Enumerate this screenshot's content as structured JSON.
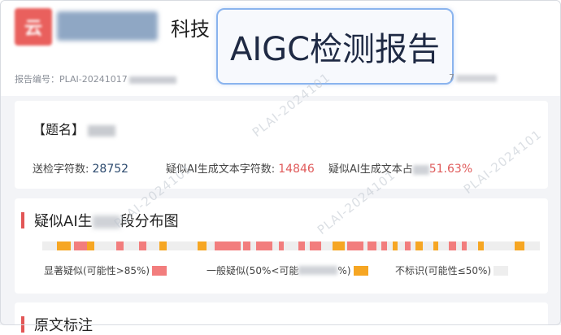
{
  "header": {
    "logo_mark": "云",
    "company_suffix": "科技",
    "report_title": "AIGC检测报告",
    "report_no_label": "报告编号：PLAI-20241017",
    "right_meta_prefix": "7"
  },
  "info": {
    "title_label": "【题名】",
    "stats": [
      {
        "label": "送检字符数: ",
        "value": "28752"
      },
      {
        "label": "疑似AI生成文本字符数: ",
        "value": "14846"
      },
      {
        "label": "疑似AI生成文本占",
        "value": "51.63%"
      }
    ]
  },
  "distribution": {
    "title_prefix": "疑似AI生",
    "title_suffix": "段分布图",
    "segments_fraction": [
      {
        "start": 0.03,
        "end": 0.057,
        "level": "mid"
      },
      {
        "start": 0.064,
        "end": 0.09,
        "level": "high"
      },
      {
        "start": 0.09,
        "end": 0.105,
        "level": "mid"
      },
      {
        "start": 0.148,
        "end": 0.163,
        "level": "high"
      },
      {
        "start": 0.195,
        "end": 0.21,
        "level": "high"
      },
      {
        "start": 0.235,
        "end": 0.249,
        "level": "mid"
      },
      {
        "start": 0.312,
        "end": 0.33,
        "level": "mid"
      },
      {
        "start": 0.347,
        "end": 0.4,
        "level": "high"
      },
      {
        "start": 0.404,
        "end": 0.418,
        "level": "high"
      },
      {
        "start": 0.43,
        "end": 0.463,
        "level": "high"
      },
      {
        "start": 0.475,
        "end": 0.485,
        "level": "high"
      },
      {
        "start": 0.514,
        "end": 0.527,
        "level": "high"
      },
      {
        "start": 0.537,
        "end": 0.56,
        "level": "high"
      },
      {
        "start": 0.583,
        "end": 0.607,
        "level": "mid"
      },
      {
        "start": 0.613,
        "end": 0.646,
        "level": "high"
      },
      {
        "start": 0.654,
        "end": 0.672,
        "level": "high"
      },
      {
        "start": 0.681,
        "end": 0.692,
        "level": "high"
      },
      {
        "start": 0.705,
        "end": 0.715,
        "level": "mid"
      },
      {
        "start": 0.729,
        "end": 0.741,
        "level": "high"
      },
      {
        "start": 0.75,
        "end": 0.764,
        "level": "mid"
      },
      {
        "start": 0.786,
        "end": 0.795,
        "level": "mid"
      },
      {
        "start": 0.817,
        "end": 0.832,
        "level": "high"
      },
      {
        "start": 0.843,
        "end": 0.852,
        "level": "high"
      },
      {
        "start": 0.875,
        "end": 0.887,
        "level": "mid"
      },
      {
        "start": 0.949,
        "end": 0.969,
        "level": "mid"
      }
    ],
    "legend": {
      "high_label": "显著疑似(可能性>85%)",
      "mid_prefix": "一般疑似(50%<可能",
      "mid_suffix": "%)",
      "none_label": "不标识(可能性≤50%)"
    },
    "colors": {
      "high": "#f27d7d",
      "mid": "#f6a623",
      "none": "#eeeeee",
      "accent": "#e25656"
    }
  },
  "original": {
    "title": "原文标注"
  },
  "watermark": "PLAI-2024101"
}
